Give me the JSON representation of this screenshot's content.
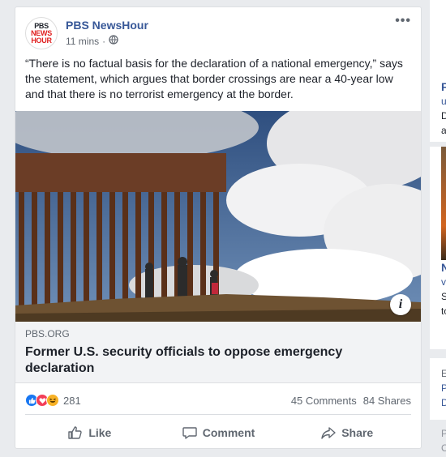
{
  "post": {
    "page_name": "PBS NewsHour",
    "avatar_text": [
      "PBS",
      "NEWS",
      "HOUR"
    ],
    "time": "11 mins",
    "privacy_icon": "globe-icon",
    "more_icon": "more-dots-icon",
    "text": "“There is no factual basis for the declaration of a national emergency,” says the statement, which argues that border crossings are near a 40-year low and that there is no terrorist emergency at the border.",
    "link": {
      "domain": "PBS.ORG",
      "title": "Former U.S. security officials to oppose emergency declaration",
      "info_icon": "info-icon"
    },
    "reactions": {
      "count": "281",
      "types": [
        "like",
        "love",
        "haha"
      ],
      "comments": "45 Comments",
      "shares": "84 Shares"
    },
    "actions": {
      "like": "Like",
      "comment": "Comment",
      "share": "Share"
    }
  },
  "sidebar": {
    "block1": [
      "F",
      "u",
      "D",
      "a"
    ],
    "block2": [
      "N",
      "v",
      "S",
      "to"
    ],
    "block3": [
      "E",
      "P",
      "D"
    ],
    "block4": [
      "P",
      "C"
    ]
  },
  "colors": {
    "link_blue": "#385898",
    "background": "#e9ebee",
    "like_blue": "#1877f2",
    "love_red": "#f33e58",
    "haha_yellow": "#f7b125"
  }
}
